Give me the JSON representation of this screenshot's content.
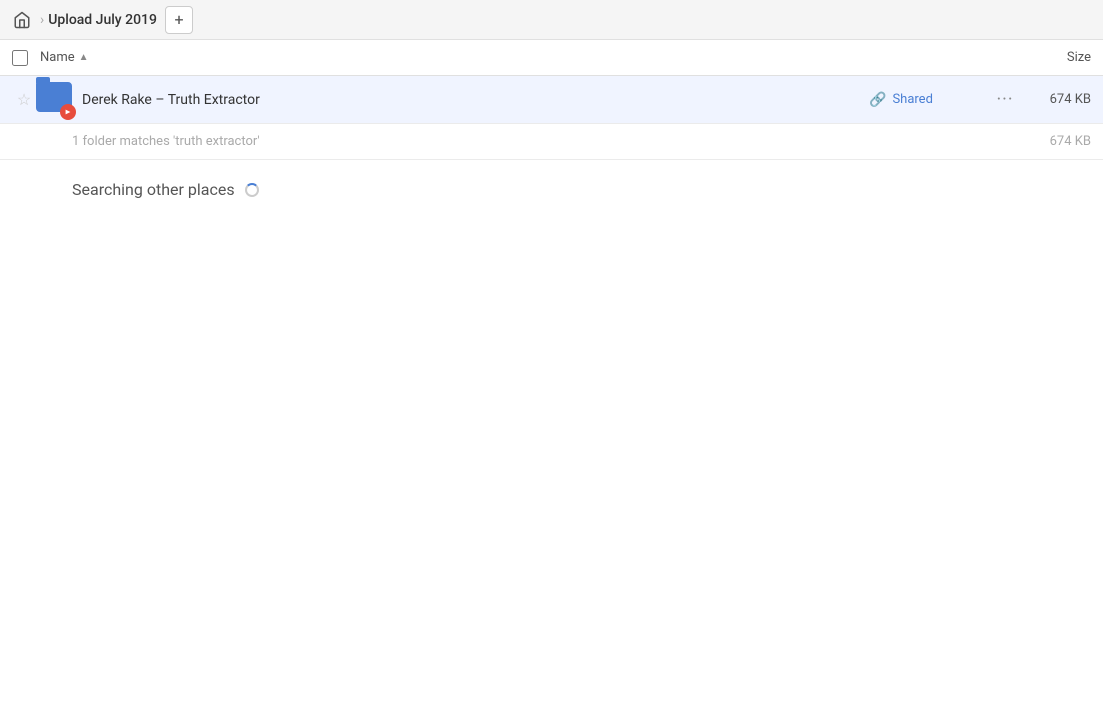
{
  "topbar": {
    "home_label": "Home",
    "breadcrumb_title": "Upload July 2019",
    "add_button_label": "+"
  },
  "columns": {
    "name_label": "Name",
    "size_label": "Size"
  },
  "file_row": {
    "name": "Derek Rake – Truth Extractor",
    "shared_label": "Shared",
    "size": "674 KB",
    "more_label": "···"
  },
  "matches": {
    "text": "1 folder matches 'truth extractor'",
    "size": "674 KB"
  },
  "searching": {
    "text": "Searching other places"
  }
}
